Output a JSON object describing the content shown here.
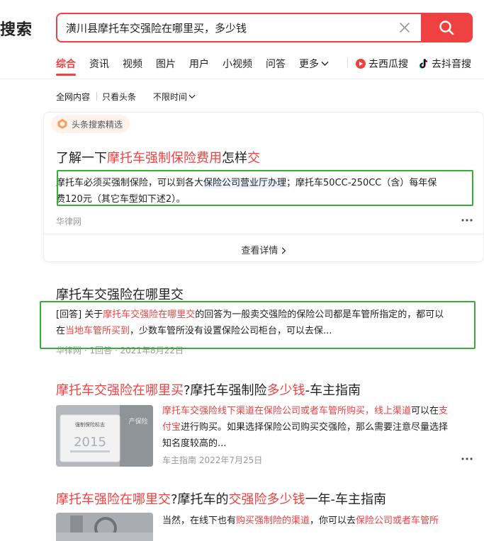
{
  "header": {
    "logo_text": "搜索",
    "search_value": "潢川县摩托车交强险在哪里买，多少钱"
  },
  "tabs": [
    {
      "label": "综合",
      "active": true
    },
    {
      "label": "资讯"
    },
    {
      "label": "视频"
    },
    {
      "label": "图片"
    },
    {
      "label": "用户"
    },
    {
      "label": "小视频"
    },
    {
      "label": "问答"
    },
    {
      "label": "更多"
    }
  ],
  "external_tabs": [
    {
      "label": "去西瓜搜",
      "icon": "xigua-icon"
    },
    {
      "label": "去抖音搜",
      "icon": "douyin-icon"
    }
  ],
  "filters": [
    "全网内容",
    "只看头条",
    "不限时间"
  ],
  "featured": {
    "badge": "头条搜索精选",
    "title_parts": [
      "了解一下",
      "摩托车强制保险费用",
      "怎样",
      "交"
    ],
    "snippet_line1_parts": [
      "摩托车必须买强制保险，可以到各大",
      "保险公司营业厅办理",
      "；摩托车50CC-250CC（含）每年保"
    ],
    "snippet_line2": "费120元（其它车型如下述2）。",
    "source": "华律网",
    "view_detail": "查看详情"
  },
  "results": [
    {
      "title": "摩托车交强险在哪里交",
      "snippet_line1_parts": [
        "[回答] 关于",
        "摩托车交强险在哪里交",
        "的回答为一般卖交强险的保险公司都是车管所指定的，都可以"
      ],
      "snippet_line2_parts": [
        "在",
        "当地车管所买到",
        "，少数车管所没有设置保险公司柜台，可以去保..."
      ],
      "meta": "华律网 · 1回答 · 2021年8月22日"
    },
    {
      "title_parts": [
        "摩托车交强险在哪里买",
        "?摩托车强制险",
        "多少钱",
        "-车主指南"
      ],
      "snippet_line1_parts": [
        "摩托车交强险线下渠道在保险公司或者车管所购买，线上渠道",
        "可以在",
        "支"
      ],
      "snippet_line2_parts": [
        "付宝",
        "进行购买。如果选择保险公司购买交强险，那么需要注意尽量选择"
      ],
      "snippet_line3": "知名度较高的...",
      "meta": "车主指南  2022年7月25日",
      "thumb_texts": [
        "强制保险标志",
        "2015",
        "产保险"
      ]
    },
    {
      "title_parts": [
        "摩托车强险在哪里交",
        "?摩托车的",
        "交强险多少钱",
        "一年-车主指南"
      ],
      "snippet_line1_parts": [
        "当然，在线下也有",
        "购买强制险的渠道",
        "，你可以去",
        "保险公司或者车管所"
      ]
    }
  ]
}
